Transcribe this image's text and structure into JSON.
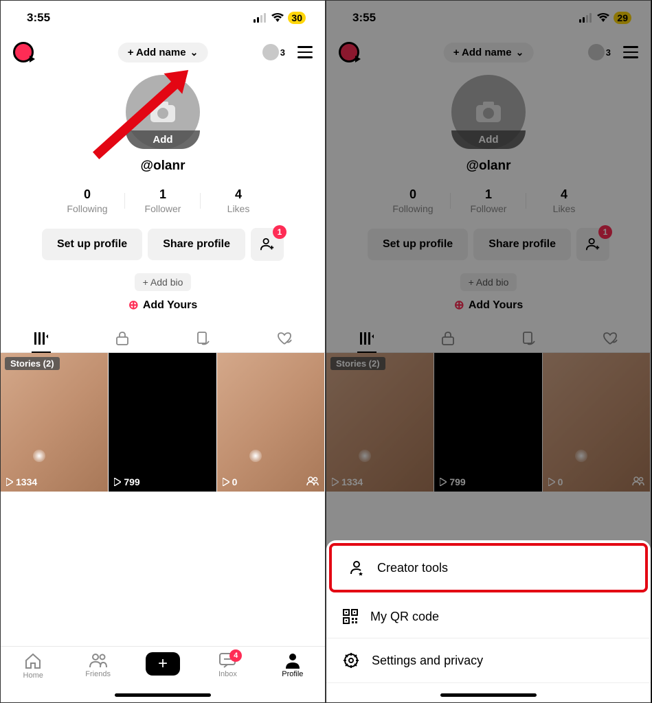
{
  "status": {
    "time": "3:55",
    "battery_left": "30",
    "battery_right": "29"
  },
  "topbar": {
    "add_name": "+ Add name",
    "viewer_count": "3"
  },
  "profile": {
    "avatar_add": "Add",
    "username": "@olanr"
  },
  "stats": {
    "following": {
      "num": "0",
      "label": "Following"
    },
    "follower": {
      "num": "1",
      "label": "Follower"
    },
    "likes": {
      "num": "4",
      "label": "Likes"
    }
  },
  "actions": {
    "setup": "Set up profile",
    "share": "Share profile",
    "friend_badge": "1"
  },
  "bio": {
    "add_bio": "+ Add bio",
    "add_yours": "Add Yours"
  },
  "grid": {
    "stories": "Stories (2)",
    "play1": "1334",
    "play2": "799",
    "play3": "0"
  },
  "nav": {
    "home": "Home",
    "friends": "Friends",
    "inbox": "Inbox",
    "inbox_badge": "4",
    "profile": "Profile"
  },
  "sheet": {
    "creator": "Creator tools",
    "qr": "My QR code",
    "settings": "Settings and privacy"
  }
}
